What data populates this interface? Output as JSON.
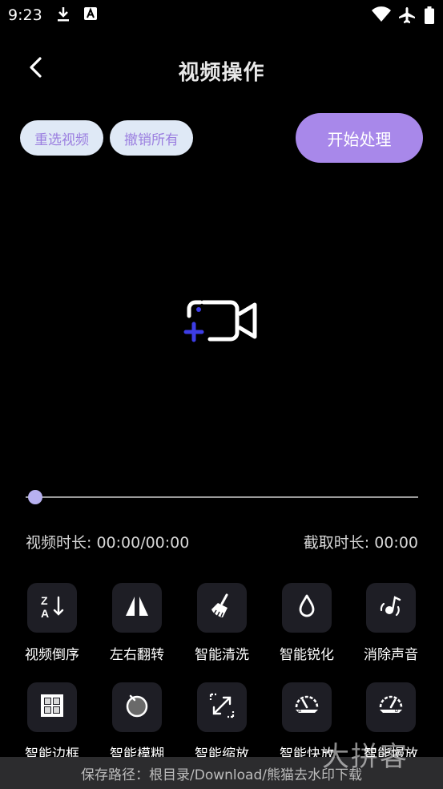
{
  "status_bar": {
    "time": "9:23",
    "icons": [
      "download-icon",
      "a-badge-icon",
      "wifi-icon",
      "airplane-mode-icon",
      "battery-icon"
    ]
  },
  "header": {
    "title": "视频操作",
    "back_icon": "chevron-left-icon"
  },
  "actions": {
    "reselect_label": "重选视频",
    "undo_all_label": "撤销所有",
    "start_label": "开始处理"
  },
  "preview": {
    "icon": "add-video-icon"
  },
  "slider": {
    "value": 0
  },
  "durations": {
    "video": "视频时长: 00:00/00:00",
    "clip": "截取时长: 00:00"
  },
  "tools": [
    {
      "label": "视频倒序",
      "icon": "sort-z-a-icon"
    },
    {
      "label": "左右翻转",
      "icon": "flip-horizontal-icon"
    },
    {
      "label": "智能清洗",
      "icon": "broom-icon"
    },
    {
      "label": "智能锐化",
      "icon": "droplet-icon"
    },
    {
      "label": "消除声音",
      "icon": "mute-sound-icon"
    },
    {
      "label": "智能边框",
      "icon": "border-frame-icon"
    },
    {
      "label": "智能模糊",
      "icon": "blur-lens-icon"
    },
    {
      "label": "智能缩放",
      "icon": "resize-arrows-icon"
    },
    {
      "label": "智能快放",
      "icon": "speed-up-gauge-icon"
    },
    {
      "label": "智能慢放",
      "icon": "slow-down-gauge-icon"
    }
  ],
  "footer": {
    "save_path": "保存路径：根目录/Download/熊猫去水印下载"
  },
  "watermark": "大拼客",
  "colors": {
    "accent": "#a888ea",
    "pill_bg": "#dfe9f6",
    "pill_text": "#9b7fe0",
    "tool_bg": "#1e1e25",
    "footer_bg": "#2c2c2e",
    "icon_blue": "#3d3de6"
  }
}
